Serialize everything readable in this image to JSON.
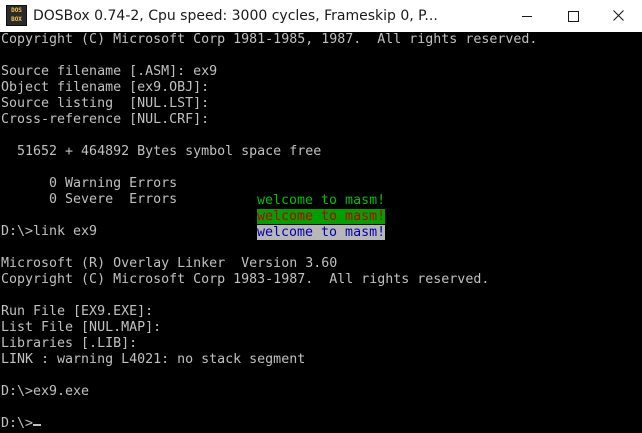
{
  "window": {
    "title": "DOSBox 0.74-2, Cpu speed:     3000 cycles, Frameskip  0, P...",
    "icon_text_top": "DOS",
    "icon_text_bottom": "BOX"
  },
  "terminal": {
    "background": "#000000",
    "text_color": "#c0c0c0",
    "lines": [
      "Copyright (C) Microsoft Corp 1981-1985, 1987.  All rights reserved.",
      "",
      "Source filename [.ASM]: ex9",
      "Object filename [ex9.OBJ]:",
      "Source listing  [NUL.LST]:",
      "Cross-reference [NUL.CRF]:",
      "",
      "  51652 + 464892 Bytes symbol space free",
      "",
      "      0 Warning Errors",
      "      0 Severe  Errors",
      "",
      "D:\\>link ex9",
      "",
      "Microsoft (R) Overlay Linker  Version 3.60",
      "Copyright (C) Microsoft Corp 1983-1987.  All rights reserved.",
      "",
      "Run File [EX9.EXE]:",
      "List File [NUL.MAP]:",
      "Libraries [.LIB]:",
      "LINK : warning L4021: no stack segment",
      "",
      "D:\\>ex9.exe",
      "",
      "D:\\>"
    ],
    "program_output": [
      {
        "text": "welcome to masm!",
        "fg": "#00c000",
        "bg": "#000000"
      },
      {
        "text": "welcome to masm!",
        "fg": "#c00000",
        "bg": "#00a000"
      },
      {
        "text": "welcome to masm!",
        "fg": "#0000b0",
        "bg": "#b8b8b8"
      }
    ]
  }
}
